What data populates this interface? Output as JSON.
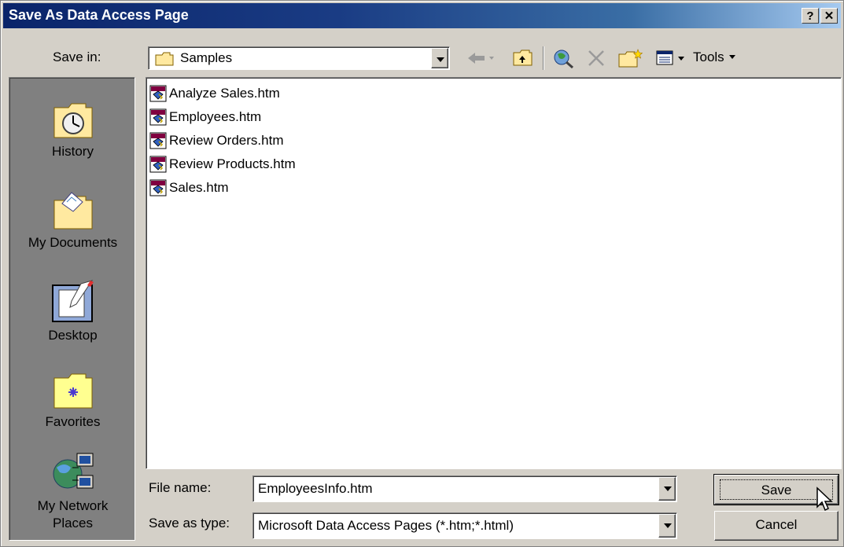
{
  "window": {
    "title": "Save As Data Access Page",
    "help_label": "?",
    "close_label": "✕"
  },
  "toolbar": {
    "save_in_label": "Save in:",
    "save_in_accel": "i",
    "location": "Samples",
    "tools_label": "Tools",
    "icons": [
      "back-arrow-icon",
      "up-folder-icon",
      "search-web-icon",
      "delete-icon",
      "new-folder-icon",
      "views-icon"
    ]
  },
  "places": [
    {
      "label": "History",
      "icon": "history-icon"
    },
    {
      "label": "My Documents",
      "icon": "my-documents-icon"
    },
    {
      "label": "Desktop",
      "icon": "desktop-icon"
    },
    {
      "label": "Favorites",
      "icon": "favorites-icon"
    },
    {
      "label": "My Network Places",
      "icon": "network-places-icon"
    }
  ],
  "files": [
    {
      "name": "Analyze Sales.htm"
    },
    {
      "name": "Employees.htm"
    },
    {
      "name": "Review Orders.htm"
    },
    {
      "name": "Review Products.htm"
    },
    {
      "name": "Sales.htm"
    }
  ],
  "form": {
    "file_name_label": "File name:",
    "file_name_value": "EmployeesInfo.htm",
    "save_type_label": "Save as type:",
    "save_type_value": "Microsoft Data Access Pages (*.htm;*.html)"
  },
  "buttons": {
    "save": "Save",
    "cancel": "Cancel"
  },
  "colors": {
    "title_start": "#0a246a",
    "title_end": "#a6caf0",
    "face": "#d4d0c8",
    "sidebar": "#808080"
  }
}
